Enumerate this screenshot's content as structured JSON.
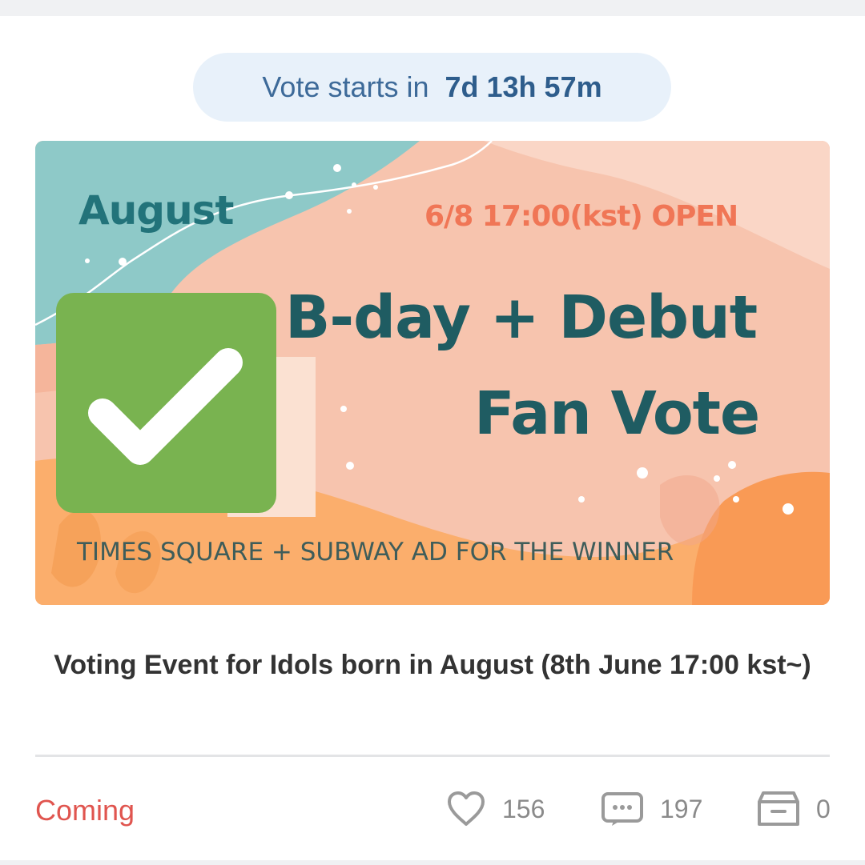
{
  "countdown": {
    "label": "Vote starts in",
    "time": "7d 13h 57m"
  },
  "banner": {
    "month": "August",
    "open_text": "6/8 17:00(kst) OPEN",
    "title_line1": "B-day + Debut",
    "title_line2": "Fan Vote",
    "subtitle": "TIMES SQUARE + SUBWAY AD FOR THE WINNER"
  },
  "event": {
    "title": "Voting Event for Idols born in August (8th June 17:00 kst~)"
  },
  "footer": {
    "status": "Coming",
    "likes": "156",
    "comments": "197",
    "saves": "0"
  },
  "colors": {
    "status": "#e0554f",
    "badge": "#79b350",
    "countdown_bg": "#e8f1fa"
  },
  "icons": [
    "checkmark-icon",
    "heart-icon",
    "comment-icon",
    "archive-icon"
  ]
}
